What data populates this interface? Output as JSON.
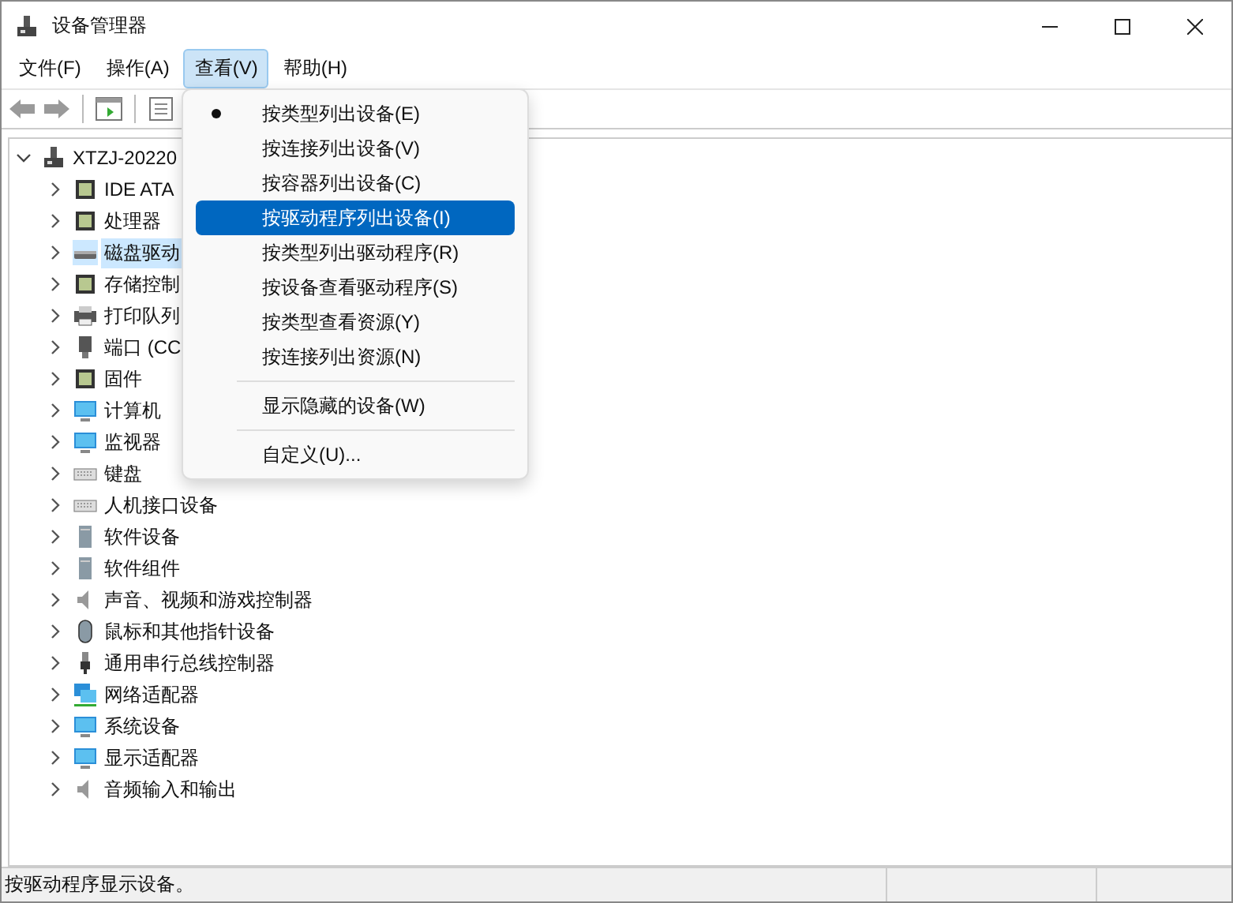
{
  "window": {
    "title": "设备管理器"
  },
  "menu_bar": [
    {
      "label": "文件(F)",
      "selected": false
    },
    {
      "label": "操作(A)",
      "selected": false
    },
    {
      "label": "查看(V)",
      "selected": true
    },
    {
      "label": "帮助(H)",
      "selected": false
    }
  ],
  "view_menu": {
    "groups": [
      [
        {
          "label": "按类型列出设备(E)",
          "checked": true,
          "selected": false
        },
        {
          "label": "按连接列出设备(V)",
          "checked": false,
          "selected": false
        },
        {
          "label": "按容器列出设备(C)",
          "checked": false,
          "selected": false
        },
        {
          "label": "按驱动程序列出设备(I)",
          "checked": false,
          "selected": true
        },
        {
          "label": "按类型列出驱动程序(R)",
          "checked": false,
          "selected": false
        },
        {
          "label": "按设备查看驱动程序(S)",
          "checked": false,
          "selected": false
        },
        {
          "label": "按类型查看资源(Y)",
          "checked": false,
          "selected": false
        },
        {
          "label": "按连接列出资源(N)",
          "checked": false,
          "selected": false
        }
      ],
      [
        {
          "label": "显示隐藏的设备(W)",
          "checked": false,
          "selected": false
        }
      ],
      [
        {
          "label": "自定义(U)...",
          "checked": false,
          "selected": false
        }
      ]
    ]
  },
  "tree": [
    {
      "label": "XTZJ-20220",
      "expanded": true,
      "selected": false,
      "children": [
        {
          "label": "IDE ATA",
          "expanded": false,
          "selected": false
        },
        {
          "label": "处理器",
          "expanded": false,
          "selected": false
        },
        {
          "label": "磁盘驱动",
          "expanded": false,
          "selected": true
        },
        {
          "label": "存储控制",
          "expanded": false,
          "selected": false
        },
        {
          "label": "打印队列",
          "expanded": false,
          "selected": false
        },
        {
          "label": "端口 (CC",
          "expanded": false,
          "selected": false
        },
        {
          "label": "固件",
          "expanded": false,
          "selected": false
        },
        {
          "label": "计算机",
          "expanded": false,
          "selected": false
        },
        {
          "label": "监视器",
          "expanded": false,
          "selected": false
        },
        {
          "label": "键盘",
          "expanded": false,
          "selected": false
        },
        {
          "label": "人机接口设备",
          "expanded": false,
          "selected": false
        },
        {
          "label": "软件设备",
          "expanded": false,
          "selected": false
        },
        {
          "label": "软件组件",
          "expanded": false,
          "selected": false
        },
        {
          "label": "声音、视频和游戏控制器",
          "expanded": false,
          "selected": false
        },
        {
          "label": "鼠标和其他指针设备",
          "expanded": false,
          "selected": false
        },
        {
          "label": "通用串行总线控制器",
          "expanded": false,
          "selected": false
        },
        {
          "label": "网络适配器",
          "expanded": false,
          "selected": false
        },
        {
          "label": "系统设备",
          "expanded": false,
          "selected": false
        },
        {
          "label": "显示适配器",
          "expanded": false,
          "selected": false
        },
        {
          "label": "音频输入和输出",
          "expanded": false,
          "selected": false
        }
      ]
    }
  ],
  "status_bar": {
    "text": "按驱动程序显示设备。"
  }
}
